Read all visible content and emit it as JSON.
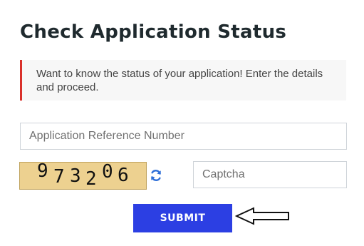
{
  "page": {
    "title": "Check Application Status",
    "notice": "Want to know the status of your application! Enter the details and proceed."
  },
  "form": {
    "reference_number": {
      "placeholder": "Application Reference Number",
      "value": ""
    },
    "captcha": {
      "image_text": "973206",
      "digits": [
        "9",
        "7",
        "3",
        "2",
        "0",
        "6"
      ],
      "placeholder": "Captcha",
      "value": "",
      "refresh_icon": "refresh-icon"
    },
    "submit_label": "SUBMIT"
  },
  "annotation": {
    "arrow_icon": "left-arrow-icon"
  },
  "colors": {
    "accent": "#2c3fe3",
    "notice_border": "#d9302a",
    "captcha_bg": "#edd190",
    "refresh": "#2e6fd8"
  }
}
